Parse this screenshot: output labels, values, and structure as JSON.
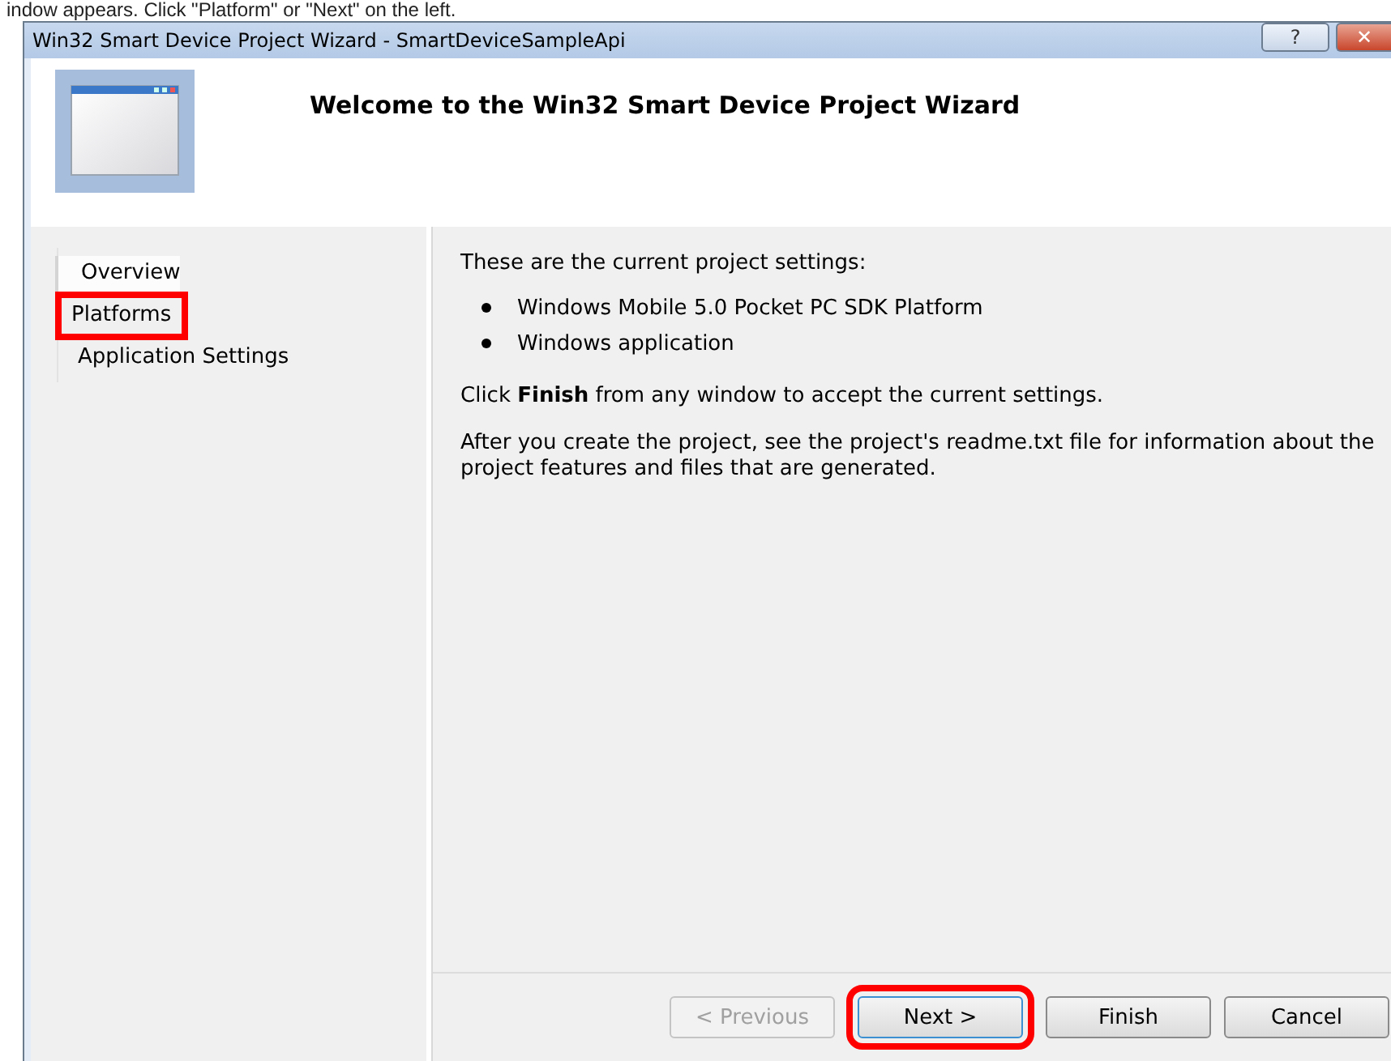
{
  "caption": "indow appears. Click \"Platform\" or \"Next\" on the left.",
  "window": {
    "title": "Win32 Smart Device Project Wizard - SmartDeviceSampleApi",
    "title_buttons": [
      "?",
      "✕"
    ]
  },
  "header": {
    "heading": "Welcome to the Win32 Smart Device Project Wizard"
  },
  "steps": [
    {
      "label": "Overview",
      "selected": true,
      "highlighted": false
    },
    {
      "label": "Platforms",
      "selected": false,
      "highlighted": true
    },
    {
      "label": "Application Settings",
      "selected": false,
      "highlighted": false
    }
  ],
  "content": {
    "intro": "These are the current project settings:",
    "settings": [
      "Windows Mobile 5.0 Pocket PC SDK Platform",
      "Windows application"
    ],
    "paragraphs": [
      "Click **Finish** from any window to accept the current settings.",
      "After you create the project, see the project's readme.txt file for information about the project features and files that are generated."
    ]
  },
  "buttons": [
    {
      "label": "< Previous",
      "disabled": true,
      "highlighted": false
    },
    {
      "label": "Next >",
      "disabled": false,
      "highlighted": true
    },
    {
      "label": "Finish",
      "disabled": false,
      "highlighted": false
    },
    {
      "label": "Cancel",
      "disabled": false,
      "highlighted": false
    }
  ]
}
